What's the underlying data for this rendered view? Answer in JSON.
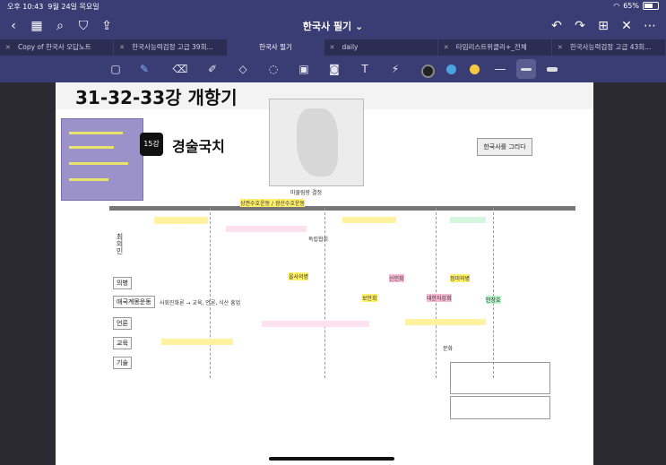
{
  "status": {
    "time": "오후 10:43",
    "date": "9월 24일 목요일",
    "battery": "65%"
  },
  "nav": {
    "title": "한국사 필기 ⌄"
  },
  "tabs": [
    {
      "label": "Copy of 한국사 오답노트",
      "active": false
    },
    {
      "label": "한국사능력검정 고급 39회...",
      "active": false
    },
    {
      "label": "한국사 필기",
      "active": true
    },
    {
      "label": "daily",
      "active": false
    },
    {
      "label": "타임리스트위클리+_전체",
      "active": false
    },
    {
      "label": "한국사능력검정 고급 43회...",
      "active": false
    }
  ],
  "colors": {
    "accent": "#3a3d73",
    "pen_black": "#222222",
    "pen_blue": "#4aa3df",
    "pen_yellow": "#f5c842"
  },
  "page": {
    "heading": "31-32-33강 개항기",
    "chapter_num": "15강",
    "chapter_title": "경술국치",
    "map_caption": "마물림랑 결정",
    "side_label": "한국사를 그리다",
    "rows": [
      "의병",
      "애국계몽운동",
      "언론",
      "교육",
      "기술"
    ],
    "row_note": "사회진화론 → 교육, 언론, 식산 흥업",
    "left_vertical": "최의민",
    "notes": {
      "n1": "상권수호운동 / 광산수호운동",
      "n2": "을사의병",
      "n3": "정미의병",
      "n4": "독립협회",
      "n5": "신민회",
      "n6": "대한자강회",
      "n7": "보안회",
      "n8": "문화",
      "n9": "안창호"
    }
  }
}
